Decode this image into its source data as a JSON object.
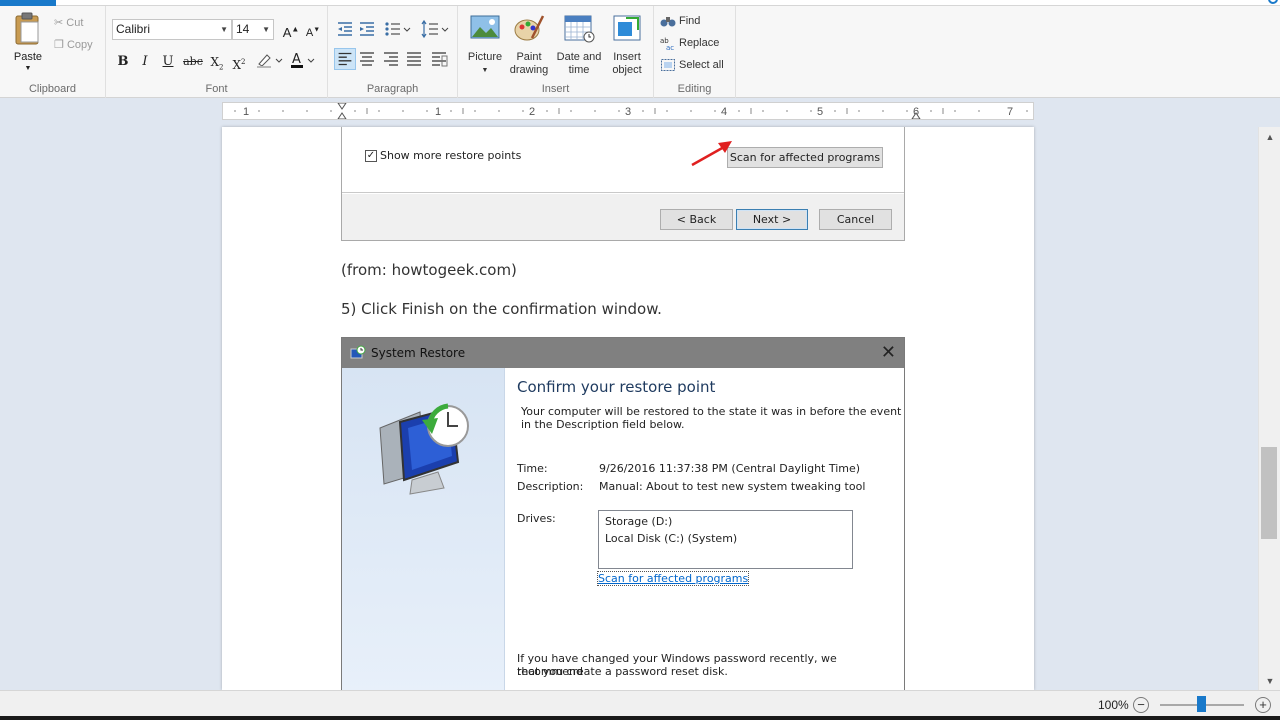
{
  "ribbon": {
    "clipboard": {
      "paste": "Paste",
      "cut": "Cut",
      "copy": "Copy",
      "group": "Clipboard"
    },
    "font": {
      "family": "Calibri",
      "size": "14",
      "group": "Font"
    },
    "paragraph": {
      "group": "Paragraph"
    },
    "insert": {
      "picture": "Picture",
      "paint_drawing_1": "Paint",
      "paint_drawing_2": "drawing",
      "date_time_1": "Date and",
      "date_time_2": "time",
      "insert_object_1": "Insert",
      "insert_object_2": "object",
      "group": "Insert"
    },
    "editing": {
      "find": "Find",
      "replace": "Replace",
      "select_all": "Select all",
      "group": "Editing"
    }
  },
  "ruler": {
    "numbers": [
      "1",
      "1",
      "2",
      "3",
      "4",
      "5",
      "6",
      "7"
    ]
  },
  "document": {
    "shot1": {
      "checkbox_label": "Show more restore points",
      "scan_button": "Scan for affected programs",
      "back_button": "< Back",
      "next_button": "Next >",
      "cancel_button": "Cancel"
    },
    "source_line": "(from: howtogeek.com)",
    "step_line": "5) Click Finish on the confirmation window.",
    "system_restore": {
      "title": "System Restore",
      "heading": "Confirm your restore point",
      "intro_1": "Your computer will be restored to the state it was in before the event",
      "intro_2": "in the Description field below.",
      "time_label": "Time:",
      "time_value": "9/26/2016 11:37:38 PM (Central Daylight Time)",
      "description_label": "Description:",
      "description_value": "Manual: About to test new system tweaking tool",
      "drives_label": "Drives:",
      "drives": [
        "Storage (D:)",
        "Local Disk (C:) (System)"
      ],
      "scan_link": "Scan for affected programs",
      "password_note_1": "If you have changed your Windows password recently, we recommend",
      "password_note_2": "that you create a password reset disk."
    }
  },
  "status": {
    "zoom": "100%",
    "zoom_level": 1.0
  }
}
